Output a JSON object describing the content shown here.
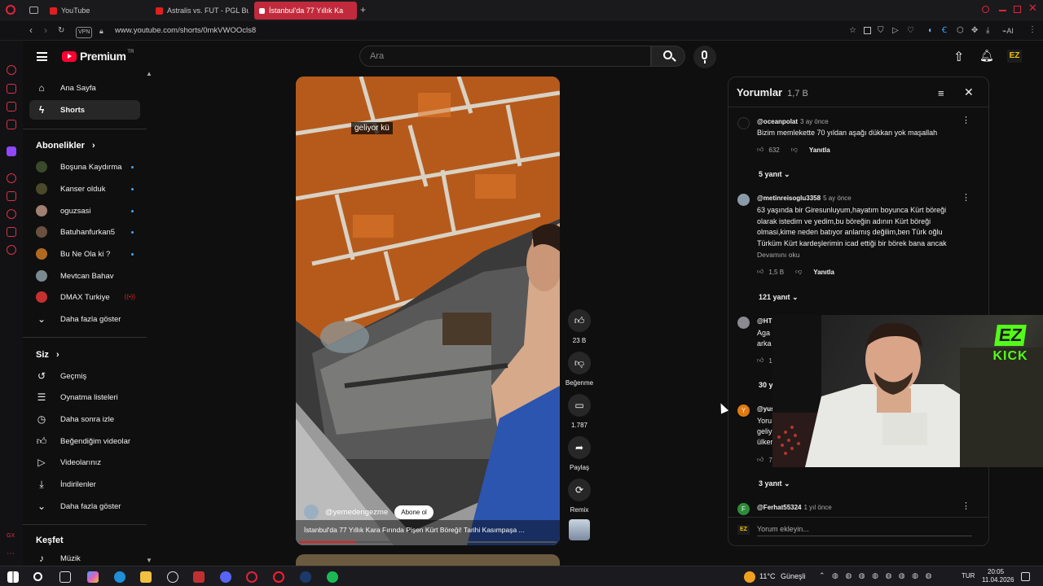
{
  "browser": {
    "tabs": [
      {
        "label": "YouTube",
        "active": false
      },
      {
        "label": "Astralis vs. FUT - PGL Buc",
        "active": false
      },
      {
        "label": "İstanbul'da 77 Yıllık Ka",
        "active": true
      }
    ],
    "url": "www.youtube.com/shorts/0mkVWOOcls8",
    "vpn_badge": "VPN",
    "ai_label": "AI",
    "accent_color": "#c12a3c"
  },
  "header": {
    "logo_text": "Premium",
    "logo_region": "TR",
    "search_placeholder": "Ara"
  },
  "sidebar": {
    "main": [
      {
        "label": "Ana Sayfa",
        "icon": "home-icon"
      },
      {
        "label": "Shorts",
        "icon": "shorts-icon",
        "active": true
      }
    ],
    "subscriptions_title": "Abonelikler",
    "subscriptions": [
      {
        "label": "Boşuna Kaydırma",
        "avatar_color": "#3a4a2a"
      },
      {
        "label": "Kanser olduk",
        "avatar_color": "#4a4a2a"
      },
      {
        "label": "oguzsasi",
        "avatar_color": "#a08070"
      },
      {
        "label": "Batuhanfurkan5",
        "avatar_color": "#6a5040"
      },
      {
        "label": "Bu Ne Ola ki ?",
        "avatar_color": "#b06a20"
      },
      {
        "label": "Mevtcan Bahav",
        "avatar_color": "#7a8a90"
      },
      {
        "label": "DMAX Turkiye",
        "avatar_color": "#c83030",
        "live": true
      }
    ],
    "show_more": "Daha fazla göster",
    "you_title": "Siz",
    "you_items": [
      {
        "label": "Geçmiş",
        "icon": "history-icon"
      },
      {
        "label": "Oynatma listeleri",
        "icon": "playlist-icon"
      },
      {
        "label": "Daha sonra izle",
        "icon": "clock-icon"
      },
      {
        "label": "Beğendiğim videolar",
        "icon": "thumbs-up-icon"
      },
      {
        "label": "Videolarınız",
        "icon": "video-icon"
      },
      {
        "label": "İndirilenler",
        "icon": "download-icon"
      }
    ],
    "show_more_2": "Daha fazla göster",
    "explore_title": "Keşfet",
    "explore_items": [
      {
        "label": "Müzik",
        "icon": "music-icon"
      }
    ]
  },
  "short": {
    "caption_overlay": "geliyor kü",
    "channel": "@yemedengezme",
    "subscribe_label": "Abone ol",
    "title": "İstanbul'da 77 Yıllık Kara Fırında Pişen Kürt Böreği! Tarihi Kasımpaşa ...",
    "likes": "23 B",
    "dislike_label": "Beğenme",
    "comments_count": "1.787",
    "share_label": "Paylaş",
    "remix_label": "Remix"
  },
  "comments_panel": {
    "title": "Yorumlar",
    "count": "1,7 B",
    "add_placeholder": "Yorum ekleyin...",
    "items": [
      {
        "author": "@oceanpolat",
        "time": "3 ay önce",
        "text": "Bizim memlekette 70 yıldan aşağı dükkan yok maşallah",
        "likes": "632",
        "reply_label": "Yanıtla",
        "replies": "5 yanıt",
        "avatar_color": "#111111"
      },
      {
        "author": "@metinreisoglu3358",
        "time": "5 ay önce",
        "text": "63 yaşında bir Giresunluyum,hayatım boyunca Kürt böreği olarak istedim ve yedim,bu böreğin adının Kürt böreği olmasi,kime neden batıyor anlamış değilim,ben Türk oğlu Türküm Kürt kardeşlerimin icad ettiği bir börek bana ancak gurur verir,bu ..",
        "read_more": "Devamını oku",
        "likes": "1,5 B",
        "reply_label": "Yanıtla",
        "replies": "121 yanıt",
        "avatar_color": "#8a9aa8"
      },
      {
        "author": "@HT",
        "text_line1": "Aga l",
        "text_line2": "arka",
        "likes": "1",
        "replies": "30 y",
        "avatar_color": "#8a8a90"
      },
      {
        "author": "@yus",
        "text_line1": "Yoru",
        "text_line2": "geliy",
        "text_line3": "ülker",
        "likes": "7",
        "replies": "3 yanıt",
        "avatar_letter": "Y",
        "avatar_color": "#e07a10"
      },
      {
        "author": "@Ferhat55324",
        "time": "1 yıl önce",
        "avatar_letter": "F",
        "avatar_color": "#2e8b3a"
      }
    ]
  },
  "webcam": {
    "badge_top": "EZ",
    "badge_bottom": "KICK",
    "badge_color": "#53fc18"
  },
  "taskbar": {
    "weather": "11°C",
    "weather_desc": "Güneşli",
    "lang": "TUR",
    "time": "20:05",
    "date": "11.04.2026"
  }
}
